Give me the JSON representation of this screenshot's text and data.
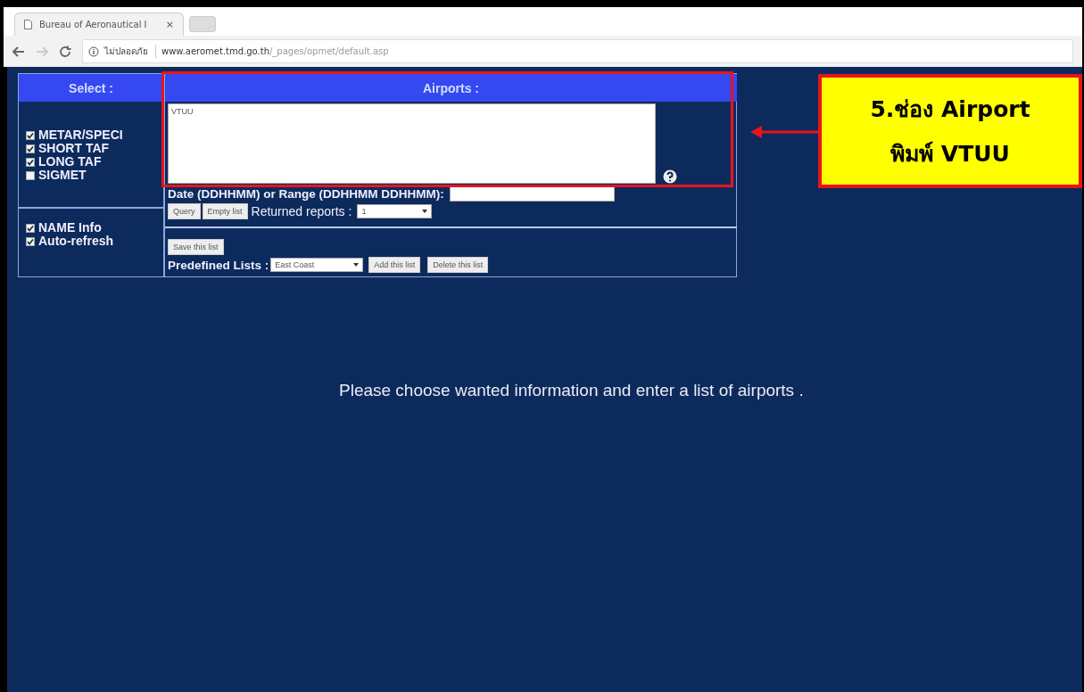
{
  "browser": {
    "tab_title": "Bureau of Aeronautical I",
    "tab_close": "×",
    "security_label": "ไม่ปลอดภัย",
    "url_host": "www.aeromet.tmd.go.th",
    "url_path": "/_pages/opmet/default.asp"
  },
  "select_panel": {
    "header": "Select :",
    "options": [
      {
        "label": "METAR/SPECI",
        "checked": true
      },
      {
        "label": "SHORT TAF",
        "checked": true
      },
      {
        "label": "LONG TAF",
        "checked": true
      },
      {
        "label": "SIGMET",
        "checked": false
      }
    ],
    "extras": [
      {
        "label": "NAME Info",
        "checked": true
      },
      {
        "label": "Auto-refresh",
        "checked": true
      }
    ]
  },
  "airports_panel": {
    "header": "Airports :",
    "airports_value": "VTUU",
    "date_label": "Date (DDHHMM) or Range (DDHHMM DDHHMM):",
    "query_buttons": [
      "Query",
      "Empty list"
    ],
    "returned_label": "Returned reports :",
    "returned_value": "1",
    "save_button": "Save this list",
    "predefined_label": "Predefined Lists :",
    "predefined_value": "East Coast",
    "list_buttons": [
      "Add this list",
      "Delete this list"
    ]
  },
  "message": "Please choose wanted information and enter a list of airports .",
  "annotation": {
    "lines": [
      "5.ช่อง Airport",
      "พิมพ์ VTUU"
    ]
  }
}
